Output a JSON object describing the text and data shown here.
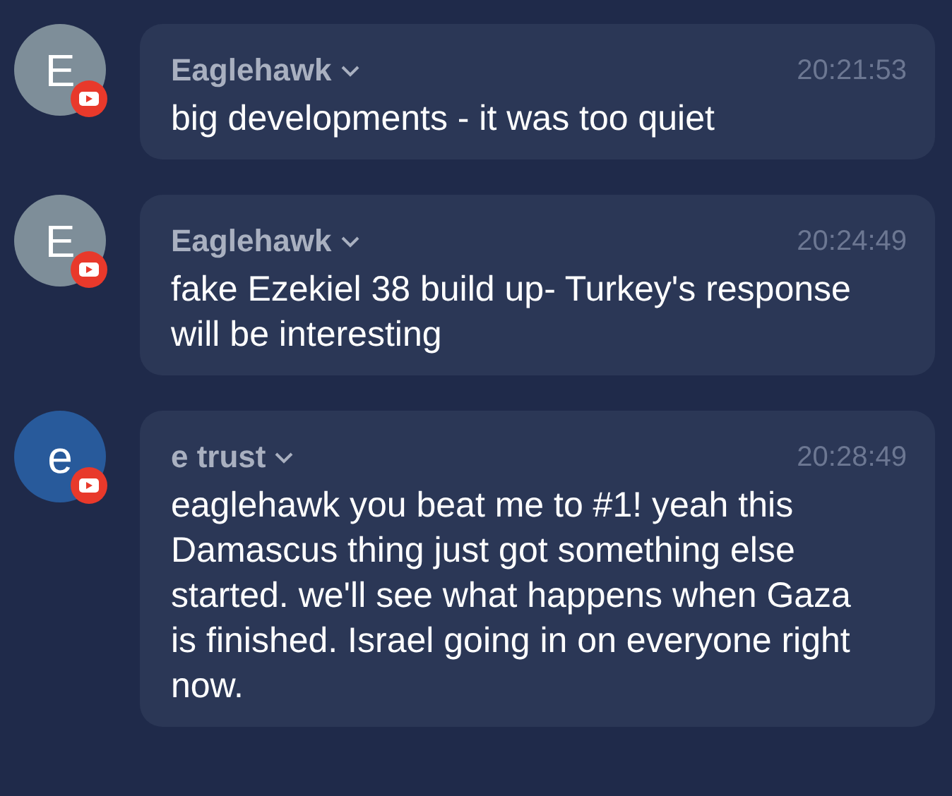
{
  "messages": [
    {
      "avatar": "E",
      "color": "#7e8e99",
      "author": "Eaglehawk",
      "time": "20:21:53",
      "text": "big developments - it was too quiet"
    },
    {
      "avatar": "E",
      "color": "#7e8e99",
      "author": "Eaglehawk",
      "time": "20:24:49",
      "text": "fake Ezekiel 38 build up- Turkey's response will be interesting"
    },
    {
      "avatar": "e",
      "color": "#285a9b",
      "author": "e trust",
      "time": "20:28:49",
      "text": "eaglehawk you beat me to #1! yeah this Damascus thing just got something else started. we'll see what happens when Gaza is finished. Israel going in on everyone right now."
    }
  ]
}
